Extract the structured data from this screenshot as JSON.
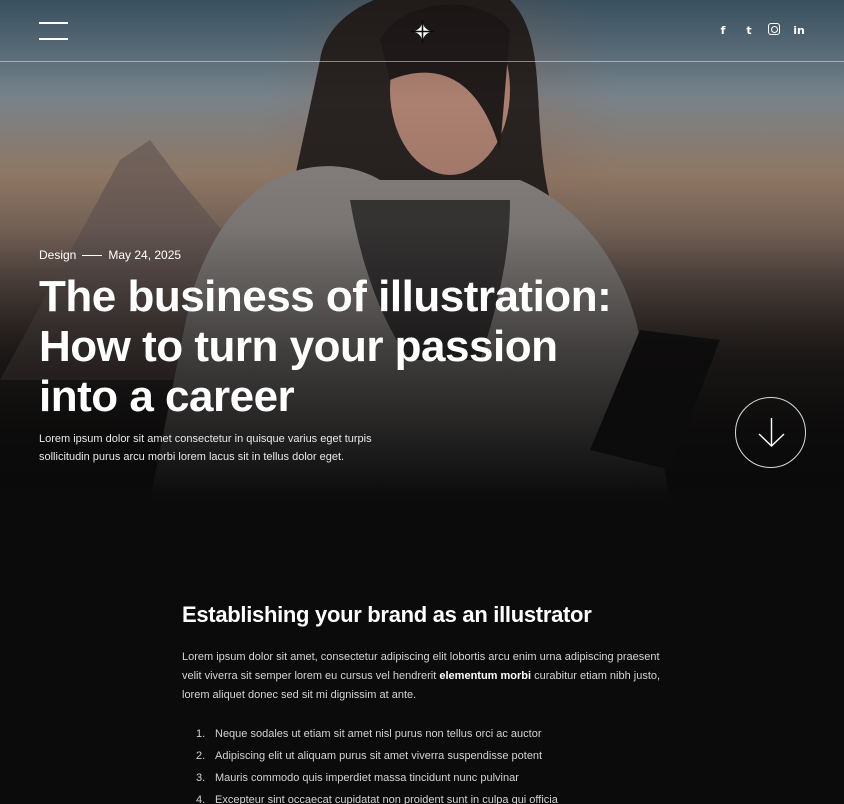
{
  "header": {
    "socials": [
      {
        "icon": "facebook-icon",
        "glyph": "f"
      },
      {
        "icon": "twitter-icon",
        "glyph": "t"
      },
      {
        "icon": "instagram-icon",
        "glyph": ""
      },
      {
        "icon": "linkedin-icon",
        "glyph": "in"
      }
    ]
  },
  "hero": {
    "category": "Design",
    "date": "May 24, 2025",
    "title_lines": [
      "The business of illustration:",
      "How to turn your passion",
      "into a career"
    ],
    "lede": "Lorem ipsum dolor sit amet consectetur in quisque varius eget turpis sollicitudin purus arcu morbi lorem lacus sit in tellus dolor eget."
  },
  "article": {
    "heading": "Establishing your brand as an illustrator",
    "paragraph_before": "Lorem ipsum dolor sit amet, consectetur adipiscing elit lobortis arcu enim urna adipiscing praesent velit viverra sit semper lorem eu cursus vel hendrerit ",
    "paragraph_bold": "elementum morbi",
    "paragraph_after": " curabitur etiam nibh justo, lorem aliquet donec sed sit mi dignissim at ante.",
    "list": [
      {
        "num": "1.",
        "text": "Neque sodales ut etiam sit amet nisl purus non tellus orci ac auctor"
      },
      {
        "num": "2.",
        "text": "Adipiscing elit ut aliquam purus sit amet viverra suspendisse potent"
      },
      {
        "num": "3.",
        "text": "Mauris commodo quis imperdiet massa tincidunt nunc pulvinar"
      },
      {
        "num": "4.",
        "text": "Excepteur sint occaecat cupidatat non proident sunt in culpa qui officia"
      }
    ]
  },
  "colors": {
    "background": "#0b0b0b",
    "text": "#ffffff",
    "muted": "#d4d4d4"
  }
}
